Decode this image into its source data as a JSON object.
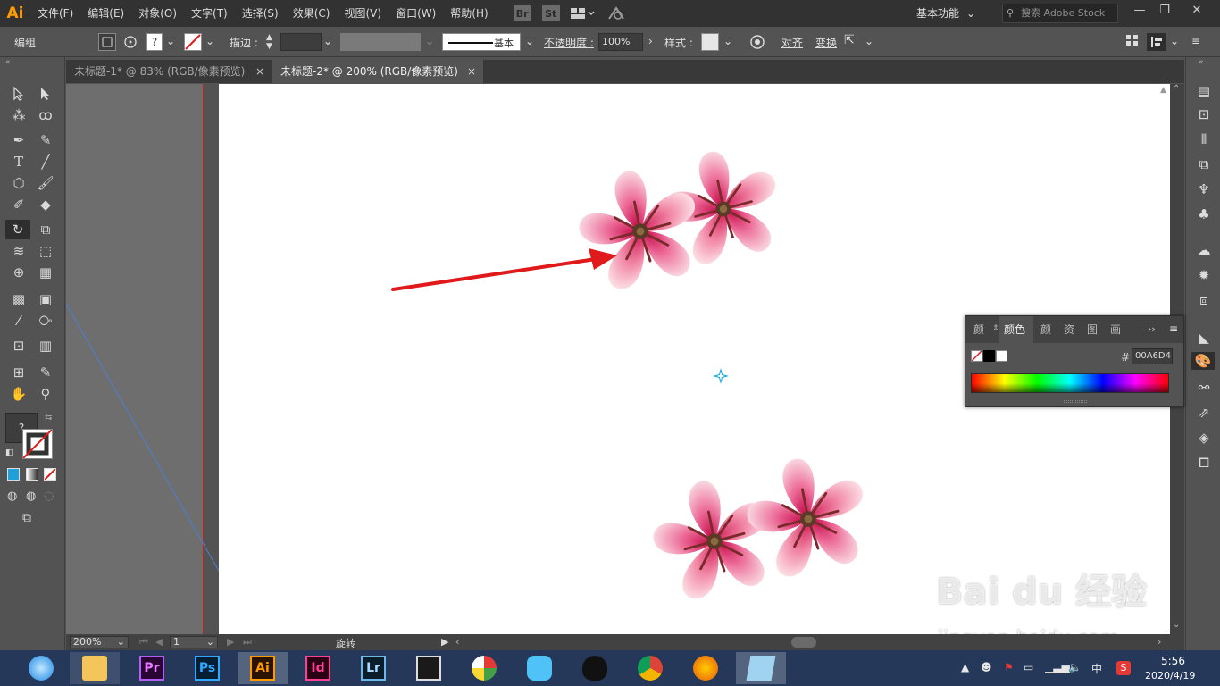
{
  "app": {
    "logo": "Ai",
    "menus": [
      "文件(F)",
      "编辑(E)",
      "对象(O)",
      "文字(T)",
      "选择(S)",
      "效果(C)",
      "视图(V)",
      "窗口(W)",
      "帮助(H)"
    ],
    "bridge_labels": [
      "Br",
      "St"
    ],
    "workspace": "基本功能",
    "search_placeholder": "搜索 Adobe Stock",
    "window_controls": [
      "—",
      "❐",
      "✕"
    ]
  },
  "control_bar": {
    "selection_label": "编组",
    "stroke_label": "描边 :",
    "stroke_style": "基本",
    "opacity_label": "不透明度 :",
    "opacity_value": "100%",
    "style_label": "样式 :",
    "align_label": "对齐",
    "transform_label": "变换"
  },
  "tabs": [
    {
      "label": "未标题-1* @ 83% (RGB/像素预览)",
      "close": "×",
      "active": false
    },
    {
      "label": "未标题-2* @ 200% (RGB/像素预览)",
      "close": "×",
      "active": true
    }
  ],
  "status_bar": {
    "zoom": "200%",
    "artboard_number": "1",
    "current_tool": "旋转"
  },
  "color_panel": {
    "tabs": [
      "颜",
      "颜色",
      "颜",
      "资",
      "图",
      "画"
    ],
    "hex_label": "#",
    "hex_value": "00A6D4"
  },
  "taskbar": {
    "apps": [
      "Pr",
      "Ps",
      "Ai",
      "Id",
      "Lr"
    ],
    "time": "5:56",
    "date": "2020/4/19",
    "ime": "中"
  },
  "watermark": {
    "brand": "Bai du 经验",
    "url": "jingyan.baidu.com"
  },
  "colors": {
    "ui_dark": "#323232",
    "ui_mid": "#535353",
    "accent_blue": "#00A6D4",
    "flower_pink": "#e0457a",
    "arrow_red": "#e01a1a"
  }
}
